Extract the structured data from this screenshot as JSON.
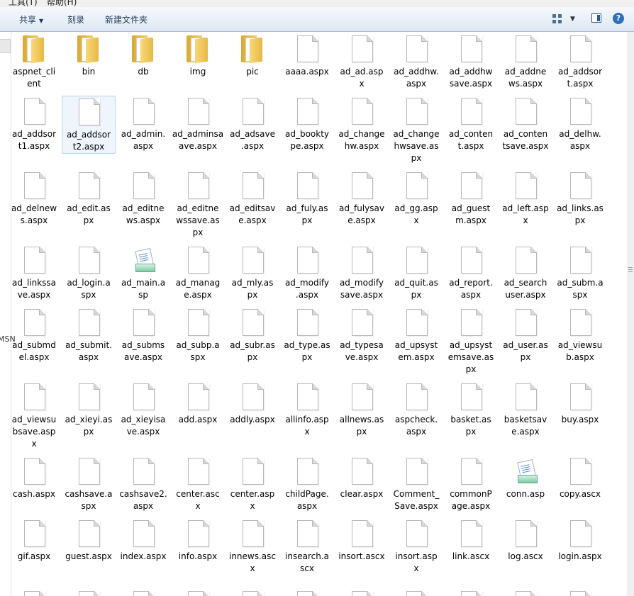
{
  "menu": [
    "工具(T)",
    "帮助(H)"
  ],
  "toolbar": {
    "share_label": "共享",
    "burn_label": "刻录",
    "new_folder_label": "新建文件夹",
    "help_glyph": "?"
  },
  "left_pane": {
    "partial_text": "MSN"
  },
  "items": [
    {
      "name": "aspnet_client",
      "type": "folder",
      "label": "aspnet_cli\nent"
    },
    {
      "name": "bin",
      "type": "folder",
      "label": "bin"
    },
    {
      "name": "db",
      "type": "folder",
      "label": "db"
    },
    {
      "name": "img",
      "type": "folder",
      "label": "img"
    },
    {
      "name": "pic",
      "type": "folder",
      "label": "pic"
    },
    {
      "name": "aaaa.aspx",
      "type": "file",
      "label": "aaaa.aspx"
    },
    {
      "name": "ad_ad.aspx",
      "type": "file",
      "label": "ad_ad.asp\nx"
    },
    {
      "name": "ad_addhw.aspx",
      "type": "file",
      "label": "ad_addhw.\naspx"
    },
    {
      "name": "ad_addhwsave.aspx",
      "type": "file",
      "label": "ad_addhw\nsave.aspx"
    },
    {
      "name": "ad_addnews.aspx",
      "type": "file",
      "label": "ad_addne\nws.aspx"
    },
    {
      "name": "ad_addsort.aspx",
      "type": "file",
      "label": "ad_addsor\nt.aspx"
    },
    {
      "name": "ad_addsort1.aspx",
      "type": "file",
      "label": "ad_addsor\nt1.aspx"
    },
    {
      "name": "ad_addsort2.aspx",
      "type": "file",
      "label": "ad_addsor\nt2.aspx",
      "selected": true
    },
    {
      "name": "ad_admin.aspx",
      "type": "file",
      "label": "ad_admin.\naspx"
    },
    {
      "name": "ad_adminsave.aspx",
      "type": "file",
      "label": "ad_adminsa\nave.aspx"
    },
    {
      "name": "ad_adsave.aspx",
      "type": "file",
      "label": "ad_adsave\n.aspx"
    },
    {
      "name": "ad_booktype.aspx",
      "type": "file",
      "label": "ad_bookty\npe.aspx"
    },
    {
      "name": "ad_changehw.aspx",
      "type": "file",
      "label": "ad_change\nhw.aspx"
    },
    {
      "name": "ad_changehwsave.aspx",
      "type": "file",
      "label": "ad_change\nhwsave.as\npx"
    },
    {
      "name": "ad_content.aspx",
      "type": "file",
      "label": "ad_conten\nt.aspx"
    },
    {
      "name": "ad_contentsave.aspx",
      "type": "file",
      "label": "ad_conten\ntsave.aspx"
    },
    {
      "name": "ad_delhw.aspx",
      "type": "file",
      "label": "ad_delhw.\naspx"
    },
    {
      "name": "ad_delnews.aspx",
      "type": "file",
      "label": "ad_delnew\ns.aspx"
    },
    {
      "name": "ad_edit.aspx",
      "type": "file",
      "label": "ad_edit.as\npx"
    },
    {
      "name": "ad_editnews.aspx",
      "type": "file",
      "label": "ad_editne\nws.aspx"
    },
    {
      "name": "ad_editnewssave.aspx",
      "type": "file",
      "label": "ad_editne\nwssave.as\npx"
    },
    {
      "name": "ad_editsave.aspx",
      "type": "file",
      "label": "ad_editsav\ne.aspx"
    },
    {
      "name": "ad_fuly.aspx",
      "type": "file",
      "label": "ad_fuly.as\npx"
    },
    {
      "name": "ad_fulysave.aspx",
      "type": "file",
      "label": "ad_fulysav\ne.aspx"
    },
    {
      "name": "ad_gg.aspx",
      "type": "file",
      "label": "ad_gg.asp\nx"
    },
    {
      "name": "ad_guestm.aspx",
      "type": "file",
      "label": "ad_guest\nm.aspx"
    },
    {
      "name": "ad_left.aspx",
      "type": "file",
      "label": "ad_left.asp\nx"
    },
    {
      "name": "ad_links.aspx",
      "type": "file",
      "label": "ad_links.as\npx"
    },
    {
      "name": "ad_linkssave.aspx",
      "type": "file",
      "label": "ad_linkssa\nve.aspx"
    },
    {
      "name": "ad_login.aspx",
      "type": "file",
      "label": "ad_login.a\nspx"
    },
    {
      "name": "ad_main.asp",
      "type": "asp",
      "label": "ad_main.a\nsp"
    },
    {
      "name": "ad_manage.aspx",
      "type": "file",
      "label": "ad_manag\ne.aspx"
    },
    {
      "name": "ad_mly.aspx",
      "type": "file",
      "label": "ad_mly.as\npx"
    },
    {
      "name": "ad_modify.aspx",
      "type": "file",
      "label": "ad_modify\n.aspx"
    },
    {
      "name": "ad_modifysave.aspx",
      "type": "file",
      "label": "ad_modify\nsave.aspx"
    },
    {
      "name": "ad_quit.aspx",
      "type": "file",
      "label": "ad_quit.as\npx"
    },
    {
      "name": "ad_report.aspx",
      "type": "file",
      "label": "ad_report.\naspx"
    },
    {
      "name": "ad_searchuser.aspx",
      "type": "file",
      "label": "ad_search\nuser.aspx"
    },
    {
      "name": "ad_subm.aspx",
      "type": "file",
      "label": "ad_subm.a\nspx"
    },
    {
      "name": "ad_submdel.aspx",
      "type": "file",
      "label": "ad_submd\nel.aspx"
    },
    {
      "name": "ad_submit.aspx",
      "type": "file",
      "label": "ad_submit.\naspx"
    },
    {
      "name": "ad_submsave.aspx",
      "type": "file",
      "label": "ad_subms\nave.aspx"
    },
    {
      "name": "ad_subp.aspx",
      "type": "file",
      "label": "ad_subp.a\nspx"
    },
    {
      "name": "ad_subr.aspx",
      "type": "file",
      "label": "ad_subr.as\npx"
    },
    {
      "name": "ad_type.aspx",
      "type": "file",
      "label": "ad_type.as\npx"
    },
    {
      "name": "ad_typesave.aspx",
      "type": "file",
      "label": "ad_typesa\nve.aspx"
    },
    {
      "name": "ad_upsystem.aspx",
      "type": "file",
      "label": "ad_upsyst\nem.aspx"
    },
    {
      "name": "ad_upsystemsave.aspx",
      "type": "file",
      "label": "ad_upsyst\nemsave.as\npx"
    },
    {
      "name": "ad_user.aspx",
      "type": "file",
      "label": "ad_user.as\npx"
    },
    {
      "name": "ad_viewsub.aspx",
      "type": "file",
      "label": "ad_viewsu\nb.aspx"
    },
    {
      "name": "ad_viewsubsave.aspx",
      "type": "file",
      "label": "ad_viewsu\nbsave.asp\nx"
    },
    {
      "name": "ad_xieyi.aspx",
      "type": "file",
      "label": "ad_xieyi.as\npx"
    },
    {
      "name": "ad_xieyisave.aspx",
      "type": "file",
      "label": "ad_xieyisa\nve.aspx"
    },
    {
      "name": "add.aspx",
      "type": "file",
      "label": "add.aspx"
    },
    {
      "name": "addly.aspx",
      "type": "file",
      "label": "addly.aspx"
    },
    {
      "name": "allinfo.aspx",
      "type": "file",
      "label": "allinfo.asp\nx"
    },
    {
      "name": "allnews.aspx",
      "type": "file",
      "label": "allnews.as\npx"
    },
    {
      "name": "aspcheck.aspx",
      "type": "file",
      "label": "aspcheck.\naspx"
    },
    {
      "name": "basket.aspx",
      "type": "file",
      "label": "basket.as\npx"
    },
    {
      "name": "basketsave.aspx",
      "type": "file",
      "label": "basketsav\ne.aspx"
    },
    {
      "name": "buy.aspx",
      "type": "file",
      "label": "buy.aspx"
    },
    {
      "name": "cash.aspx",
      "type": "file",
      "label": "cash.aspx"
    },
    {
      "name": "cashsave.aspx",
      "type": "file",
      "label": "cashsave.a\nspx"
    },
    {
      "name": "cashsave2.aspx",
      "type": "file",
      "label": "cashsave2.\naspx"
    },
    {
      "name": "center.ascx",
      "type": "file",
      "label": "center.asc\nx"
    },
    {
      "name": "center.aspx",
      "type": "file",
      "label": "center.asp\nx"
    },
    {
      "name": "childPage.aspx",
      "type": "file",
      "label": "childPage.\naspx"
    },
    {
      "name": "clear.aspx",
      "type": "file",
      "label": "clear.aspx"
    },
    {
      "name": "Comment_Save.aspx",
      "type": "file",
      "label": "Comment_\nSave.aspx"
    },
    {
      "name": "commonPage.aspx",
      "type": "file",
      "label": "commonP\nage.aspx"
    },
    {
      "name": "conn.asp",
      "type": "asp",
      "label": "conn.asp"
    },
    {
      "name": "copy.ascx",
      "type": "file",
      "label": "copy.ascx"
    },
    {
      "name": "gif.aspx",
      "type": "file",
      "label": "gif.aspx"
    },
    {
      "name": "guest.aspx",
      "type": "file",
      "label": "guest.aspx"
    },
    {
      "name": "index.aspx",
      "type": "file",
      "label": "index.aspx"
    },
    {
      "name": "info.aspx",
      "type": "file",
      "label": "info.aspx"
    },
    {
      "name": "innews.ascx",
      "type": "file",
      "label": "innews.asc\nx"
    },
    {
      "name": "insearch.ascx",
      "type": "file",
      "label": "insearch.a\nscx"
    },
    {
      "name": "insort.ascx",
      "type": "file",
      "label": "insort.ascx"
    },
    {
      "name": "insort.aspx",
      "type": "file",
      "label": "insort.asp\nx"
    },
    {
      "name": "link.ascx",
      "type": "file",
      "label": "link.ascx"
    },
    {
      "name": "log.ascx",
      "type": "file",
      "label": "log.ascx"
    },
    {
      "name": "login.aspx",
      "type": "file",
      "label": "login.aspx"
    },
    {
      "name": "partial-1",
      "type": "file",
      "label": ""
    },
    {
      "name": "partial-2",
      "type": "file",
      "label": ""
    },
    {
      "name": "partial-3",
      "type": "file",
      "label": ""
    },
    {
      "name": "partial-4",
      "type": "file",
      "label": ""
    },
    {
      "name": "partial-5",
      "type": "file",
      "label": ""
    },
    {
      "name": "partial-6",
      "type": "file",
      "label": ""
    },
    {
      "name": "partial-7",
      "type": "file",
      "label": ""
    },
    {
      "name": "partial-8",
      "type": "file",
      "label": ""
    },
    {
      "name": "partial-9",
      "type": "file",
      "label": ""
    },
    {
      "name": "partial-10",
      "type": "file",
      "label": ""
    },
    {
      "name": "partial-11",
      "type": "file",
      "label": ""
    }
  ]
}
